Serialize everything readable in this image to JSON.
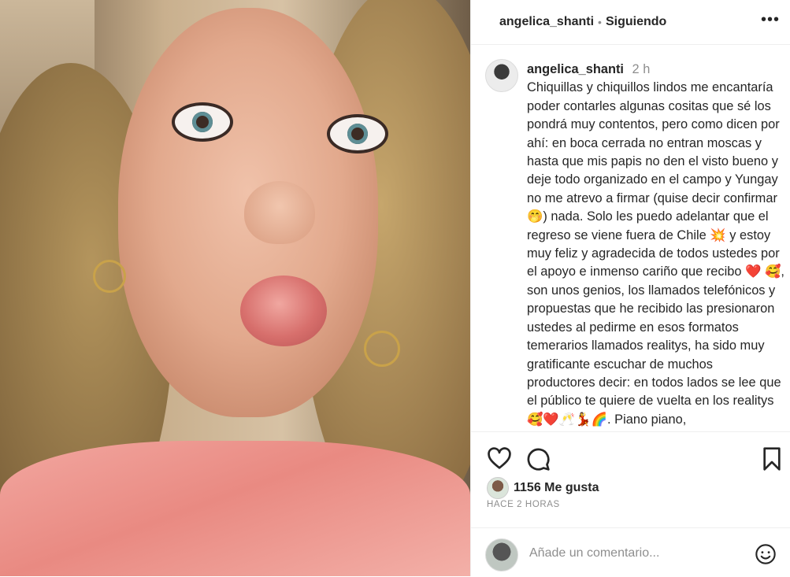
{
  "post": {
    "username": "angelica_shanti",
    "follow_status": "Siguiendo",
    "separator": "•",
    "more_icon": "more-horizontal-icon"
  },
  "caption": {
    "username": "angelica_shanti",
    "time": "2 h",
    "text": "Chiquillas y chiquillos lindos me encantaría poder contarles algunas cositas que sé los pondrá muy contentos, pero como dicen por ahí: en boca cerrada no entran moscas y hasta que mis papis no den el visto bueno y deje todo organizado en el campo y Yungay no me atrevo a firmar (quise decir confirmar 🤭) nada. Solo les puedo adelantar que el regreso se viene fuera de Chile 💥 y estoy muy feliz y agradecida de todos ustedes por el apoyo e inmenso cariño que recibo ❤️ 🥰, son unos genios, los llamados telefónicos y propuestas que he recibido las presionaron ustedes al pedirme en esos formatos temerarios llamados realitys, ha sido muy gratificante escuchar de muchos productores decir: en todos lados se lee que el público te quiere de vuelta en los realitys 🥰❤️🥂💃🌈. Piano piano,"
  },
  "actions": {
    "like_icon": "heart-icon",
    "comment_icon": "comment-icon",
    "save_icon": "bookmark-icon"
  },
  "likes": {
    "count_text": "1156 Me gusta"
  },
  "timeago": "HACE 2 HORAS",
  "comment": {
    "placeholder": "Añade un comentario...",
    "emoji_icon": "emoji-smile-icon"
  }
}
